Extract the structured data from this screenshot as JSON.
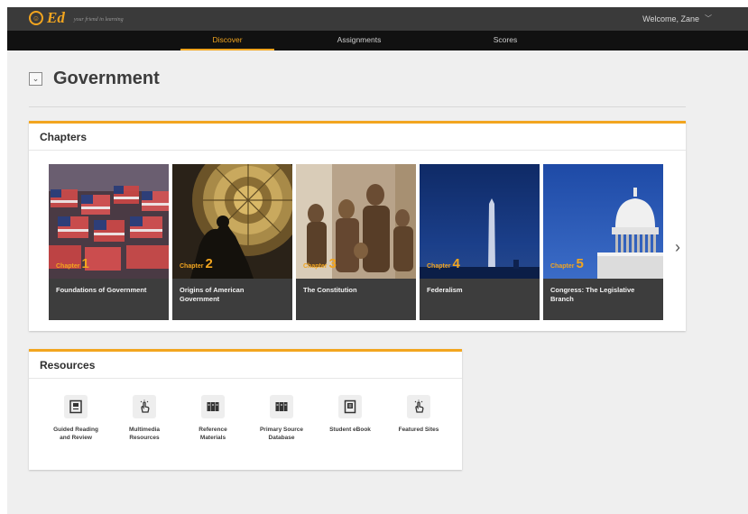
{
  "brand": {
    "logo_text": "Ed",
    "tagline": "your friend in learning"
  },
  "user": {
    "welcome": "Welcome, Zane"
  },
  "nav": {
    "discover": "Discover",
    "assignments": "Assignments",
    "scores": "Scores"
  },
  "page": {
    "title": "Government"
  },
  "chapters": {
    "heading": "Chapters",
    "chapter_prefix": "Chapter",
    "items": [
      {
        "number": "1",
        "title": "Foundations of Government",
        "image": "flags-photo"
      },
      {
        "number": "2",
        "title": "Origins of American Government",
        "image": "rotunda-photo"
      },
      {
        "number": "3",
        "title": "The Constitution",
        "image": "signers-statues-photo"
      },
      {
        "number": "4",
        "title": "Federalism",
        "image": "washington-monument-photo"
      },
      {
        "number": "5",
        "title": "Congress: The Legislative Branch",
        "image": "capitol-dome-photo"
      }
    ]
  },
  "resources": {
    "heading": "Resources",
    "items": [
      {
        "label_line1": "Guided Reading",
        "label_line2": "and Review",
        "icon": "document-icon"
      },
      {
        "label_line1": "Multimedia",
        "label_line2": "Resources",
        "icon": "touch-icon"
      },
      {
        "label_line1": "Reference",
        "label_line2": "Materials",
        "icon": "books-icon"
      },
      {
        "label_line1": "Primary Source",
        "label_line2": "Database",
        "icon": "books-icon"
      },
      {
        "label_line1": "Student eBook",
        "label_line2": "",
        "icon": "ebook-icon"
      },
      {
        "label_line1": "Featured Sites",
        "label_line2": "",
        "icon": "touch-icon"
      }
    ]
  },
  "colors": {
    "accent": "#f2a51f",
    "topbar": "#3a3a3a",
    "navbar": "#111111",
    "page_bg": "#efefef"
  }
}
